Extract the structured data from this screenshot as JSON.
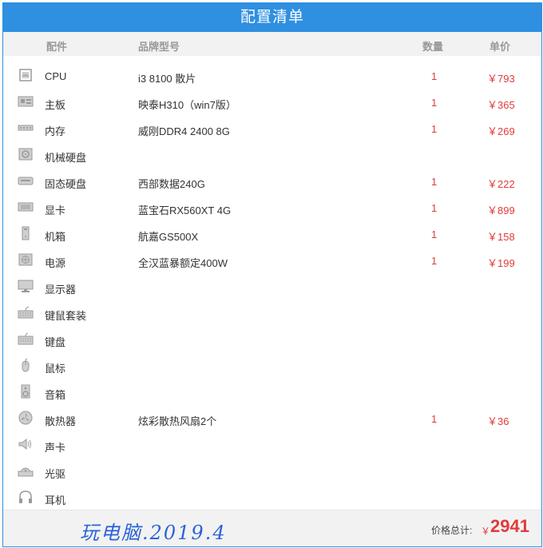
{
  "title": "配置清单",
  "columns": {
    "part": "配件",
    "brand": "品牌型号",
    "qty": "数量",
    "price": "单价"
  },
  "items": [
    {
      "icon": "cpu-icon",
      "name": "CPU",
      "brand": "i3 8100 散片",
      "qty": "1",
      "price": "￥793"
    },
    {
      "icon": "motherboard-icon",
      "name": "主板",
      "brand": "映泰H310（win7版）",
      "qty": "1",
      "price": "￥365"
    },
    {
      "icon": "memory-icon",
      "name": "内存",
      "brand": "威刚DDR4 2400 8G",
      "qty": "1",
      "price": "￥269"
    },
    {
      "icon": "hdd-icon",
      "name": "机械硬盘",
      "brand": "",
      "qty": "",
      "price": ""
    },
    {
      "icon": "ssd-icon",
      "name": "固态硬盘",
      "brand": "西部数据240G",
      "qty": "1",
      "price": "￥222"
    },
    {
      "icon": "gpu-icon",
      "name": "显卡",
      "brand": "蓝宝石RX560XT 4G",
      "qty": "1",
      "price": "￥899"
    },
    {
      "icon": "case-icon",
      "name": "机箱",
      "brand": "航嘉GS500X",
      "qty": "1",
      "price": "￥158"
    },
    {
      "icon": "psu-icon",
      "name": "电源",
      "brand": "全汉蓝暴额定400W",
      "qty": "1",
      "price": "￥199"
    },
    {
      "icon": "monitor-icon",
      "name": "显示器",
      "brand": "",
      "qty": "",
      "price": ""
    },
    {
      "icon": "keyboard-mouse-icon",
      "name": "键鼠套装",
      "brand": "",
      "qty": "",
      "price": ""
    },
    {
      "icon": "keyboard-icon",
      "name": "键盘",
      "brand": "",
      "qty": "",
      "price": ""
    },
    {
      "icon": "mouse-icon",
      "name": "鼠标",
      "brand": "",
      "qty": "",
      "price": ""
    },
    {
      "icon": "speaker-icon",
      "name": "音箱",
      "brand": "",
      "qty": "",
      "price": ""
    },
    {
      "icon": "cooler-icon",
      "name": "散热器",
      "brand": "炫彩散热风扇2个",
      "qty": "1",
      "price": "￥36"
    },
    {
      "icon": "sound-card-icon",
      "name": "声卡",
      "brand": "",
      "qty": "",
      "price": ""
    },
    {
      "icon": "optical-drive-icon",
      "name": "光驱",
      "brand": "",
      "qty": "",
      "price": ""
    },
    {
      "icon": "headphone-icon",
      "name": "耳机",
      "brand": "",
      "qty": "",
      "price": ""
    }
  ],
  "footer": {
    "signature": "玩电脑.2019.4",
    "total_label": "价格总计:",
    "currency": "￥",
    "total": "2941"
  },
  "colors": {
    "accent": "#2f8fe0",
    "price": "#e23b3b",
    "header_bg": "#f2f2f2"
  }
}
